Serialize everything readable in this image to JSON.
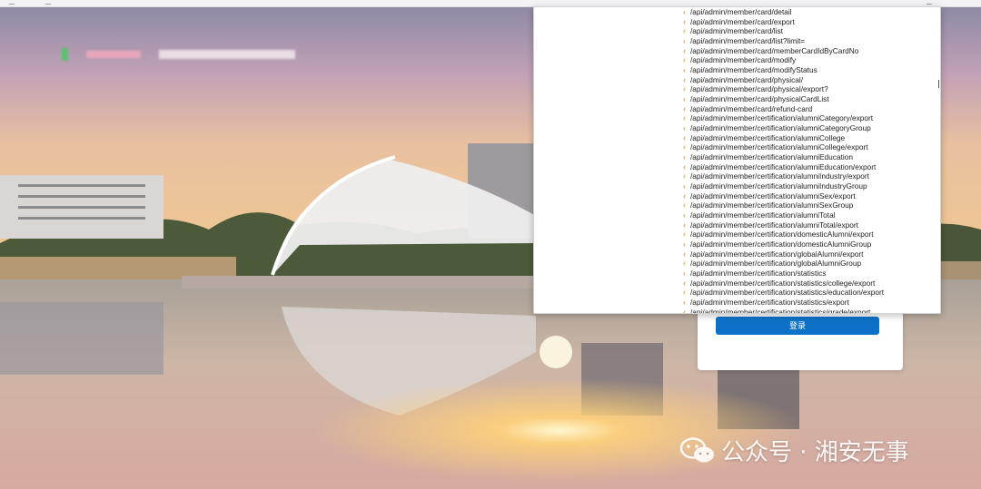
{
  "login": {
    "button_label": "登录"
  },
  "dropdown": {
    "items": [
      "/api/admin/member/card/detail",
      "/api/admin/member/card/export",
      "/api/admin/member/card/list",
      "/api/admin/member/card/list?limit=",
      "/api/admin/member/card/memberCardIdByCardNo",
      "/api/admin/member/card/modify",
      "/api/admin/member/card/modifyStatus",
      "/api/admin/member/card/physical/",
      "/api/admin/member/card/physical/export?",
      "/api/admin/member/card/physicalCardList",
      "/api/admin/member/card/refund-card",
      "/api/admin/member/certification/alumniCategory/export",
      "/api/admin/member/certification/alumniCategoryGroup",
      "/api/admin/member/certification/alumniCollege",
      "/api/admin/member/certification/alumniCollege/export",
      "/api/admin/member/certification/alumniEducation",
      "/api/admin/member/certification/alumniEducation/export",
      "/api/admin/member/certification/alumniIndustry/export",
      "/api/admin/member/certification/alumniIndustryGroup",
      "/api/admin/member/certification/alumniSex/export",
      "/api/admin/member/certification/alumniSexGroup",
      "/api/admin/member/certification/alumniTotal",
      "/api/admin/member/certification/alumniTotal/export",
      "/api/admin/member/certification/domesticAlumni/export",
      "/api/admin/member/certification/domesticAlumniGroup",
      "/api/admin/member/certification/globalAlumni/export",
      "/api/admin/member/certification/globalAlumniGroup",
      "/api/admin/member/certification/statistics",
      "/api/admin/member/certification/statistics/college/export",
      "/api/admin/member/certification/statistics/education/export",
      "/api/admin/member/certification/statistics/export",
      "/api/admin/member/certification/statistics/grade/export"
    ]
  },
  "watermark": {
    "text": "公众号 · 湘安无事"
  },
  "colors": {
    "accent": "#0d72c7",
    "chevron": "#d98a1a"
  }
}
